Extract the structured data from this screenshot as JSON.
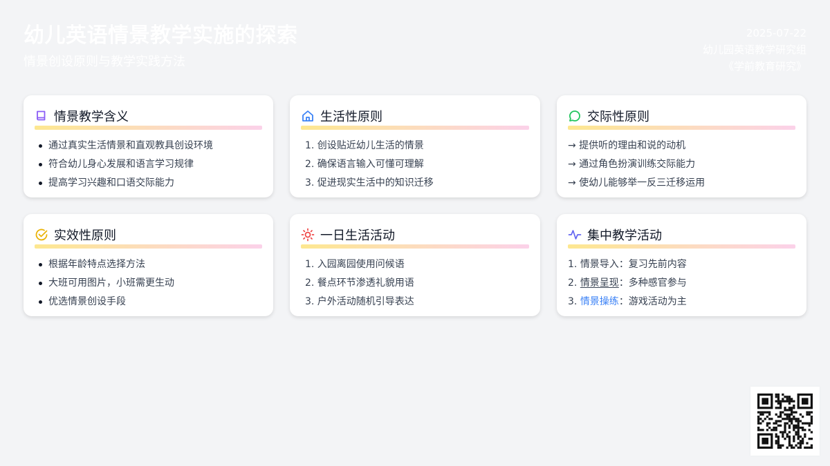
{
  "header": {
    "title": "幼儿英语情景教学实施的探索",
    "subtitle": "情景创设原则与教学实践方法",
    "date": "2025-07-22",
    "author": "幼儿园英语教学研究组",
    "source": "《学前教育研究》"
  },
  "colors": {
    "purple": "#8b5cf6",
    "blue": "#3b82f6",
    "green": "#22c55e",
    "yellow": "#eab308",
    "red": "#ef4444",
    "indigo": "#6366f1",
    "gradient_start": "#fde68a",
    "gradient_end": "#fbcfe8"
  },
  "cards": [
    {
      "title": "情景教学含义",
      "icon": "book-icon",
      "items": [
        "通过真实生活情景和直观教具创设环境",
        "符合幼儿身心发展和语言学习规律",
        "提高学习兴趣和口语交际能力"
      ]
    },
    {
      "title": "生活性原则",
      "icon": "home-icon",
      "items": [
        "1. 创设贴近幼儿生活的情景",
        "2. 确保语言输入可懂可理解",
        "3. 促进现实生活中的知识迁移"
      ]
    },
    {
      "title": "交际性原则",
      "icon": "chat-bubble-icon",
      "items": [
        "→ 提供听的理由和说的动机",
        "→ 通过角色扮演训练交际能力",
        "→ 使幼儿能够举一反三迁移运用"
      ]
    },
    {
      "title": "实效性原则",
      "icon": "check-circle-icon",
      "items": [
        "根据年龄特点选择方法",
        "大班可用图片，小班需更生动",
        "优选情景创设手段"
      ]
    },
    {
      "title": "一日生活活动",
      "icon": "sun-icon",
      "items": [
        "1. 入园离园使用问候语",
        "2. 餐点环节渗透礼貌用语",
        "3. 户外活动随机引导表达"
      ]
    },
    {
      "title": "集中教学活动",
      "icon": "activity-icon",
      "items": [
        {
          "num": "1. ",
          "label": "情景导入",
          "rest": "：复习先前内容"
        },
        {
          "num": "2. ",
          "label": "情景呈现",
          "rest": "：多种感官参与"
        },
        {
          "num": "3. ",
          "label": "情景操练",
          "rest": "：游戏活动为主"
        }
      ]
    }
  ]
}
